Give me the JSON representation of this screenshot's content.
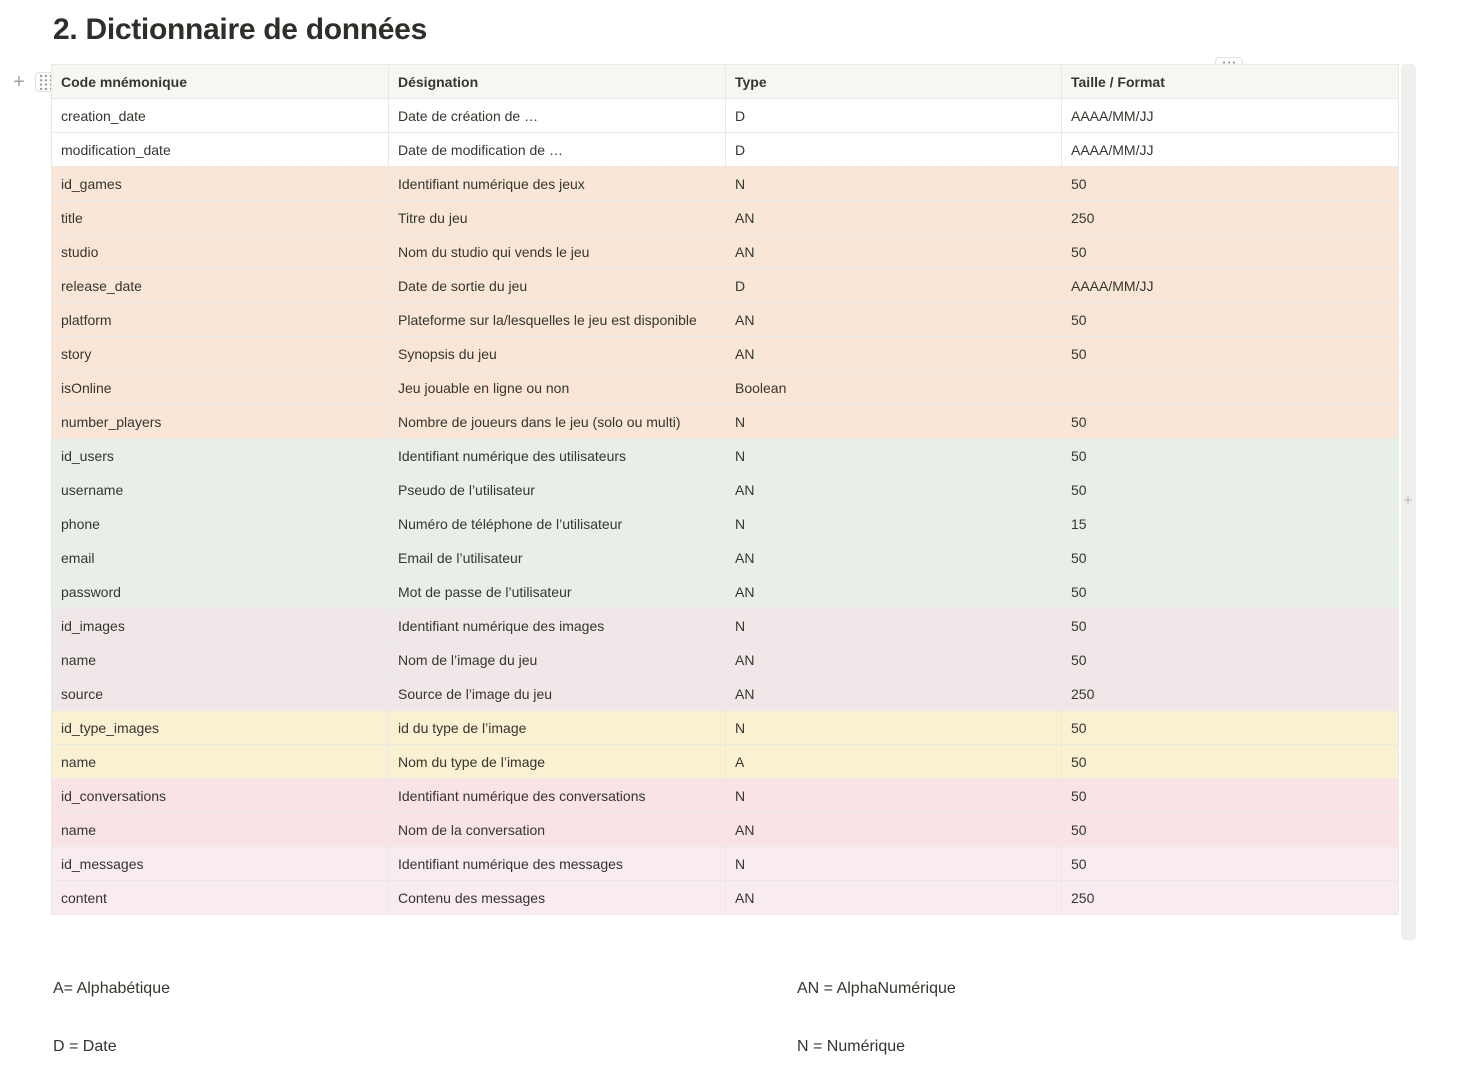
{
  "page": {
    "title": "2. Dictionnaire de données"
  },
  "table": {
    "headers": [
      "Code mnémonique",
      "Désignation",
      "Type",
      "Taille / Format"
    ],
    "rows": [
      {
        "cells": [
          "creation_date",
          "Date de création de …",
          "D",
          "AAAA/MM/JJ"
        ],
        "color": "#ffffff"
      },
      {
        "cells": [
          "modification_date",
          "Date de modification de …",
          "D",
          "AAAA/MM/JJ"
        ],
        "color": "#ffffff"
      },
      {
        "cells": [
          "id_games",
          "Identifiant numérique des jeux",
          "N",
          "50"
        ],
        "color": "#f9e6d6"
      },
      {
        "cells": [
          "title",
          "Titre du jeu",
          "AN",
          "250"
        ],
        "color": "#f9e6d6"
      },
      {
        "cells": [
          "studio",
          "Nom du studio qui vends le jeu",
          "AN",
          "50"
        ],
        "color": "#f9e6d6"
      },
      {
        "cells": [
          "release_date",
          "Date de sortie du jeu",
          "D",
          "AAAA/MM/JJ"
        ],
        "color": "#f9e6d6"
      },
      {
        "cells": [
          "platform",
          "Plateforme sur la/lesquelles le jeu est disponible",
          "AN",
          "50"
        ],
        "color": "#f9e6d6"
      },
      {
        "cells": [
          "story",
          "Synopsis du jeu",
          "AN",
          "50"
        ],
        "color": "#f9e6d6"
      },
      {
        "cells": [
          "isOnline",
          "Jeu jouable en ligne ou non",
          "Boolean",
          ""
        ],
        "color": "#f9e6d6"
      },
      {
        "cells": [
          "number_players",
          "Nombre de joueurs dans le jeu (solo ou multi)",
          "N",
          "50"
        ],
        "color": "#f9e6d6"
      },
      {
        "cells": [
          "id_users",
          "Identifiant numérique des utilisateurs",
          "N",
          "50"
        ],
        "color": "#e8efe7"
      },
      {
        "cells": [
          "username",
          "Pseudo de l’utilisateur",
          "AN",
          "50"
        ],
        "color": "#e8efe7"
      },
      {
        "cells": [
          "phone",
          "Numéro de téléphone de l’utilisateur",
          "N",
          "15"
        ],
        "color": "#e8efe7"
      },
      {
        "cells": [
          "email",
          "Email de l’utilisateur",
          "AN",
          "50"
        ],
        "color": "#e8efe7"
      },
      {
        "cells": [
          "password",
          "Mot de passe de l’utilisateur",
          "AN",
          "50"
        ],
        "color": "#e8efe7"
      },
      {
        "cells": [
          "id_images",
          "Identifiant numérique des images",
          "N",
          "50"
        ],
        "color": "#f0e8e8"
      },
      {
        "cells": [
          "name",
          "Nom de l’image du jeu",
          "AN",
          "50"
        ],
        "color": "#f0e8e8"
      },
      {
        "cells": [
          "source",
          "Source de l’image du jeu",
          "AN",
          "250"
        ],
        "color": "#f0e8e8"
      },
      {
        "cells": [
          "id_type_images",
          "id du type de l’image",
          "N",
          "50"
        ],
        "color": "#faf0d2"
      },
      {
        "cells": [
          "name",
          "Nom du type de l’image",
          "A",
          "50"
        ],
        "color": "#faf0d2"
      },
      {
        "cells": [
          "id_conversations",
          "Identifiant numérique des conversations",
          "N",
          "50"
        ],
        "color": "#f9e3e5"
      },
      {
        "cells": [
          "name",
          "Nom de la conversation",
          "AN",
          "50"
        ],
        "color": "#f9e3e5"
      },
      {
        "cells": [
          "id_messages",
          "Identifiant numérique des messages",
          "N",
          "50"
        ],
        "color": "#f8ebf1"
      },
      {
        "cells": [
          "content",
          "Contenu des messages",
          "AN",
          "250"
        ],
        "color": "#f8ebf1"
      }
    ]
  },
  "legend": {
    "alpha": "A= Alphabétique",
    "alphanumeric": "AN = AlphaNumérique",
    "date": "D = Date",
    "numeric": "N = Numérique"
  },
  "icons": {
    "row_add": "plus-icon",
    "row_drag": "grip-dots-icon",
    "column_drag": "grip-dots-icon",
    "add_column": "plus-icon"
  }
}
